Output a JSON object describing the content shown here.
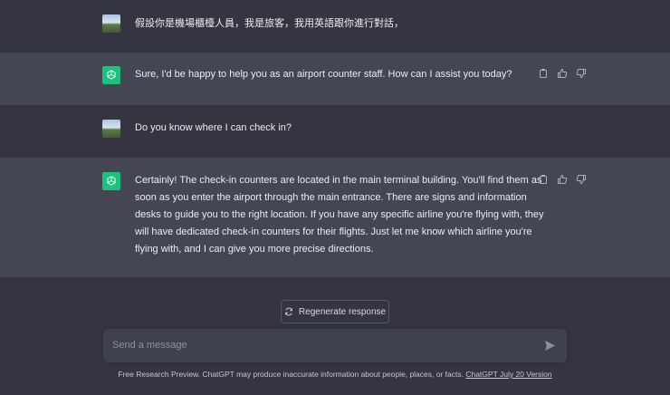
{
  "conversation": [
    {
      "role": "user",
      "text": "假設你是機場櫃檯人員，我是旅客，我用英語跟你進行對話，"
    },
    {
      "role": "assistant",
      "text": "Sure, I'd be happy to help you as an airport counter staff. How can I assist you today?"
    },
    {
      "role": "user",
      "text": "Do you know where I can check in?"
    },
    {
      "role": "assistant",
      "lines": [
        "Certainly! The check-in counters are located in the main terminal building. You'll find them as",
        "soon as you enter the airport through the main entrance. There are signs and information",
        "desks to guide you to the right location. If you have any specific airline you're flying with, they",
        "will have dedicated check-in counters for their flights. Just let me know which airline you're",
        "flying with, and I can give you more precise directions."
      ]
    }
  ],
  "regenerate_label": "Regenerate response",
  "input": {
    "placeholder": "Send a message"
  },
  "footer": {
    "text": "Free Research Preview. ChatGPT may produce inaccurate information about people, places, or facts. ",
    "link": "ChatGPT July 20 Version"
  },
  "icons": [
    "copy-icon",
    "thumbs-up-icon",
    "thumbs-down-icon",
    "refresh-icon",
    "send-icon",
    "openai-logo-icon"
  ],
  "colors": {
    "background": "#343541",
    "assistant_bg": "#444654",
    "accent": "#19c37d"
  }
}
